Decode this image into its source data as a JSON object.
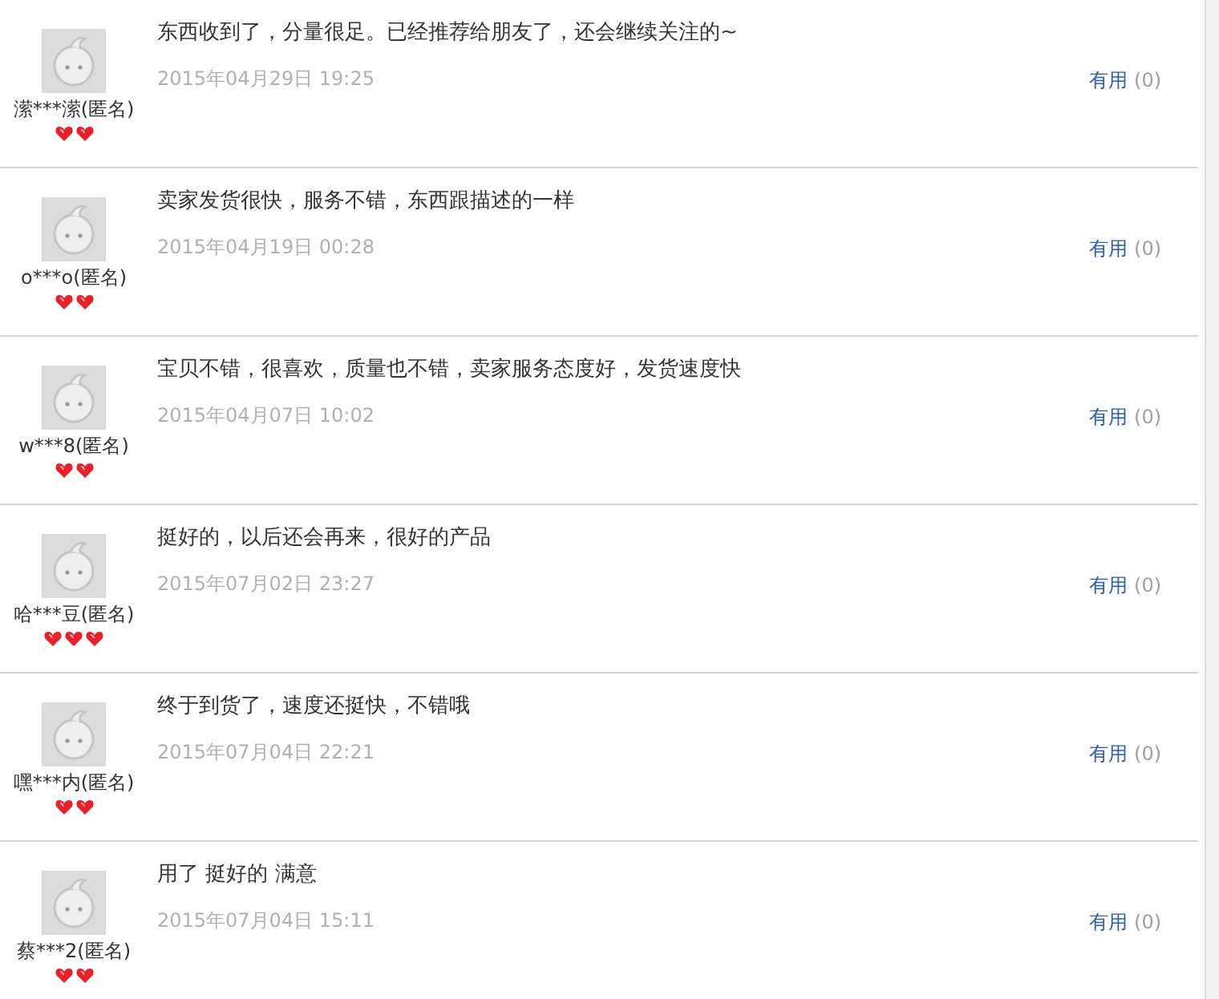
{
  "reviews": [
    {
      "user": "潆***潆(匿名)",
      "badges": [
        {
          "kind": "heart"
        },
        {
          "kind": "heart"
        }
      ],
      "text": "东西收到了，分量很足。已经推荐给朋友了，还会继续关注的~",
      "date": "2015年04月29日 19:25",
      "useful": "有用",
      "count": "(0)"
    },
    {
      "user": "o***o(匿名)",
      "badges": [
        {
          "kind": "heart"
        },
        {
          "kind": "heart"
        }
      ],
      "text": "卖家发货很快，服务不错，东西跟描述的一样",
      "date": "2015年04月19日 00:28",
      "useful": "有用",
      "count": "(0)"
    },
    {
      "user": "w***8(匿名)",
      "badges": [
        {
          "kind": "heart"
        },
        {
          "kind": "heart"
        }
      ],
      "text": "宝贝不错，很喜欢，质量也不错，卖家服务态度好，发货速度快",
      "date": "2015年04月07日 10:02",
      "useful": "有用",
      "count": "(0)"
    },
    {
      "user": "哈***豆(匿名)",
      "badges": [
        {
          "kind": "heart"
        },
        {
          "kind": "heart"
        },
        {
          "kind": "heart"
        }
      ],
      "text": "挺好的，以后还会再来，很好的产品",
      "date": "2015年07月02日 23:27",
      "useful": "有用",
      "count": "(0)"
    },
    {
      "user": "嘿***内(匿名)",
      "badges": [
        {
          "kind": "heart"
        },
        {
          "kind": "heart"
        }
      ],
      "text": "终于到货了，速度还挺快，不错哦",
      "date": "2015年07月04日 22:21",
      "useful": "有用",
      "count": "(0)"
    },
    {
      "user": "蔡***2(匿名)",
      "badges": [
        {
          "kind": "heart"
        },
        {
          "kind": "heart"
        }
      ],
      "text": "用了 挺好的 满意",
      "date": "2015年07月04日 15:11",
      "useful": "有用",
      "count": "(0)"
    }
  ]
}
